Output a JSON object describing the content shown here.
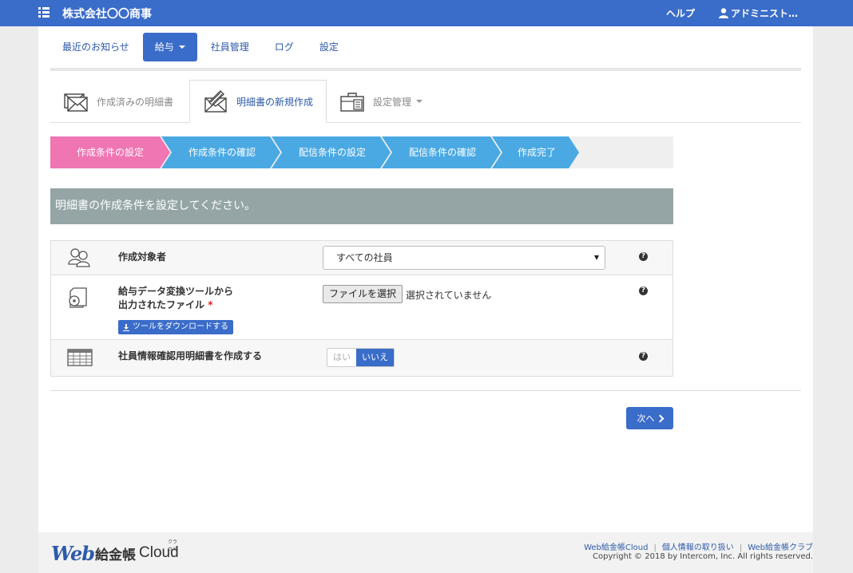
{
  "header": {
    "brand": "株式会社〇〇商事",
    "help": "ヘルプ",
    "user": "アドミニスト…"
  },
  "nav": {
    "items": [
      {
        "label": "最近のお知らせ"
      },
      {
        "label": "給与"
      },
      {
        "label": "社員管理"
      },
      {
        "label": "ログ"
      },
      {
        "label": "設定"
      }
    ]
  },
  "subtabs": {
    "items": [
      {
        "label": "作成済みの明細書"
      },
      {
        "label": "明細書の新規作成"
      },
      {
        "label": "設定管理"
      }
    ]
  },
  "steps": {
    "items": [
      {
        "label": "作成条件の設定",
        "color": "#ef75b3"
      },
      {
        "label": "作成条件の確認",
        "color": "#4aa9e3"
      },
      {
        "label": "配信条件の設定",
        "color": "#4aa9e3"
      },
      {
        "label": "配信条件の確認",
        "color": "#4aa9e3"
      },
      {
        "label": "作成完了",
        "color": "#4aa9e3"
      }
    ]
  },
  "banner": "明細書の作成条件を設定してください。",
  "form": {
    "target": {
      "label": "作成対象者",
      "value": "すべての社員"
    },
    "file": {
      "label_line1": "給与データ変換ツールから",
      "label_line2": "出力されたファイル",
      "required": "*",
      "button": "ファイルを選択",
      "status": "選択されていません",
      "download": "ツールをダウンロードする"
    },
    "confirm": {
      "label": "社員情報確認用明細書を作成する",
      "yes": "はい",
      "no": "いいえ"
    }
  },
  "next_button": "次へ",
  "footer": {
    "logo_web": "Web",
    "logo_kyu": "給金帳",
    "logo_cloud": "Cloud",
    "logo_ruby": "クラウド",
    "links": [
      "Web給金帳Cloud",
      "個人情報の取り扱い",
      "Web給金帳クラブ"
    ],
    "separator": "|",
    "copyright": "Copyright © 2018 by Intercom, Inc. All rights reserved."
  },
  "colors": {
    "primary": "#3a6cc9",
    "step_active": "#ef75b3",
    "step": "#4aa9e3",
    "banner": "#95a5a6"
  }
}
